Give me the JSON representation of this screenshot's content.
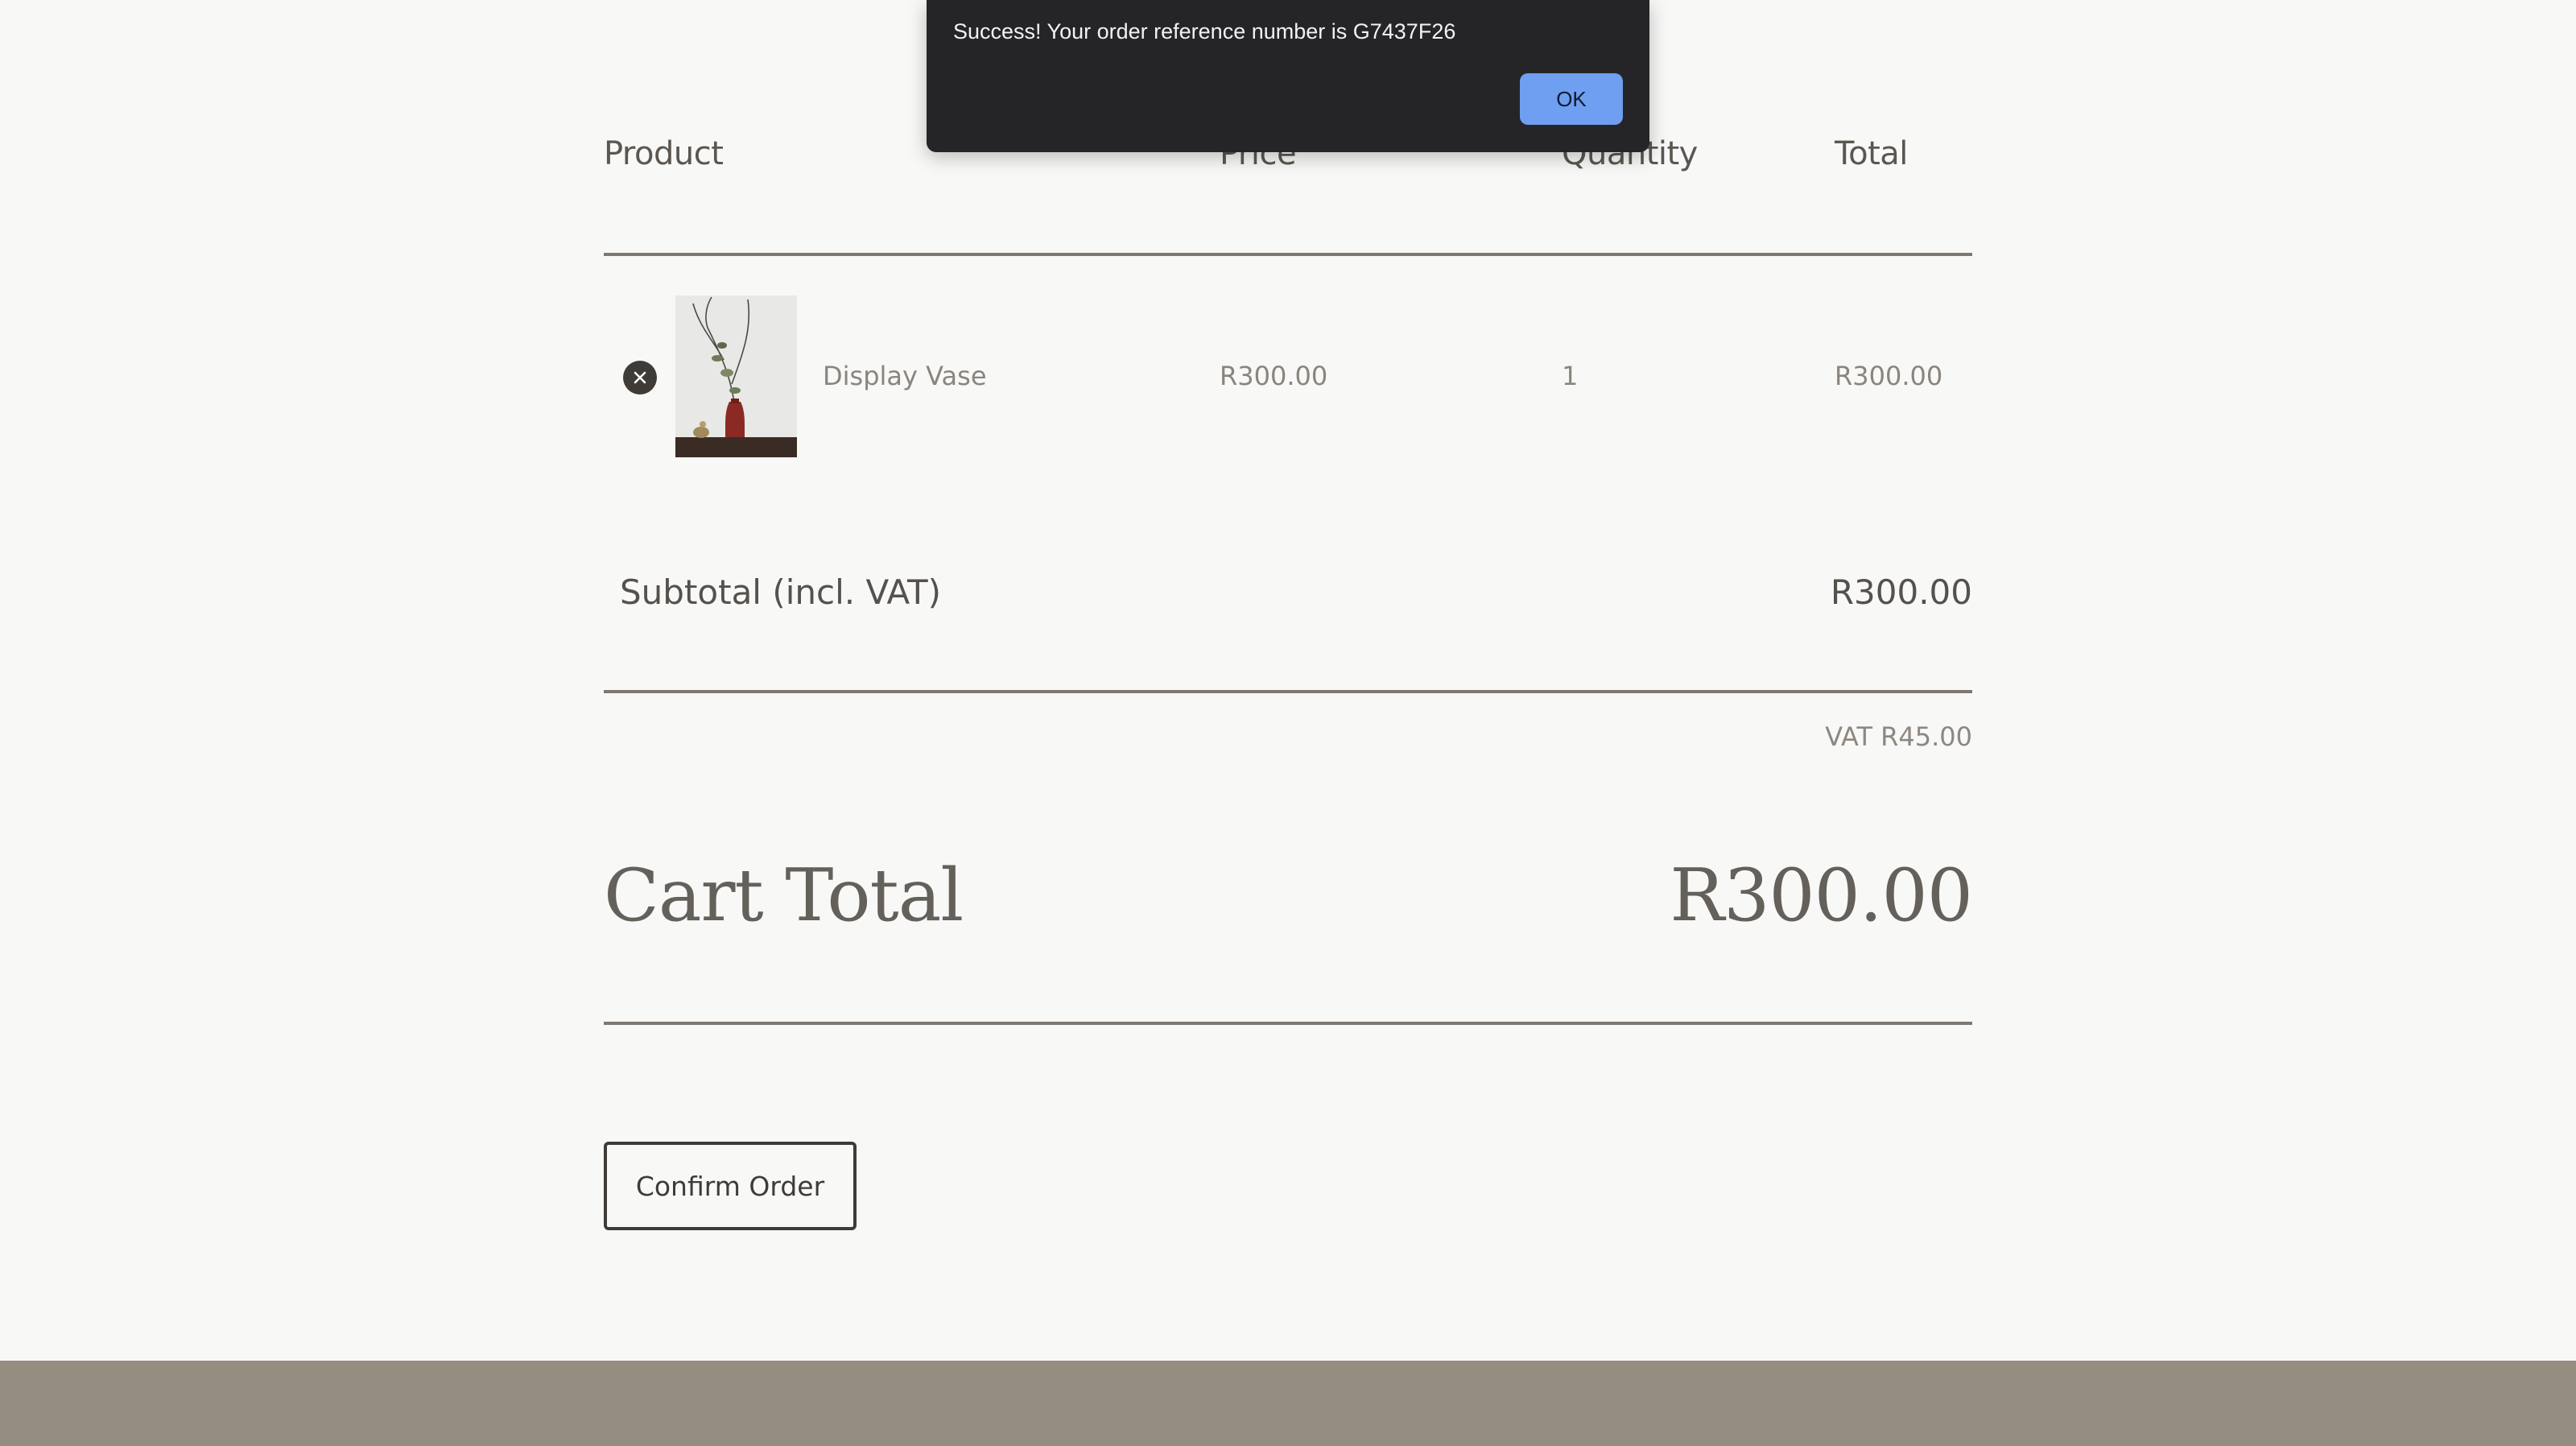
{
  "table": {
    "headers": [
      "Product",
      "Price",
      "Quantity",
      "Total"
    ],
    "rows": [
      {
        "remove_icon": "close-icon",
        "image": "vase-product-image",
        "name": "Display Vase",
        "price": "R300.00",
        "quantity": "1",
        "total": "R300.00"
      }
    ]
  },
  "summary": {
    "subtotal_label": "Subtotal (incl. VAT)",
    "subtotal_value": "R300.00",
    "vat": "VAT R45.00",
    "cart_total_label": "Cart Total",
    "cart_total_value": "R300.00"
  },
  "actions": {
    "confirm_label": "Confirm Order"
  },
  "alert": {
    "message": "Success! Your order reference number is G7437F26",
    "ok_label": "OK"
  },
  "colors": {
    "background": "#f8f8f7",
    "text": "#4f4b45",
    "footer": "#968d81",
    "alert_bg": "#252527",
    "alert_button": "#6e9ff0"
  }
}
